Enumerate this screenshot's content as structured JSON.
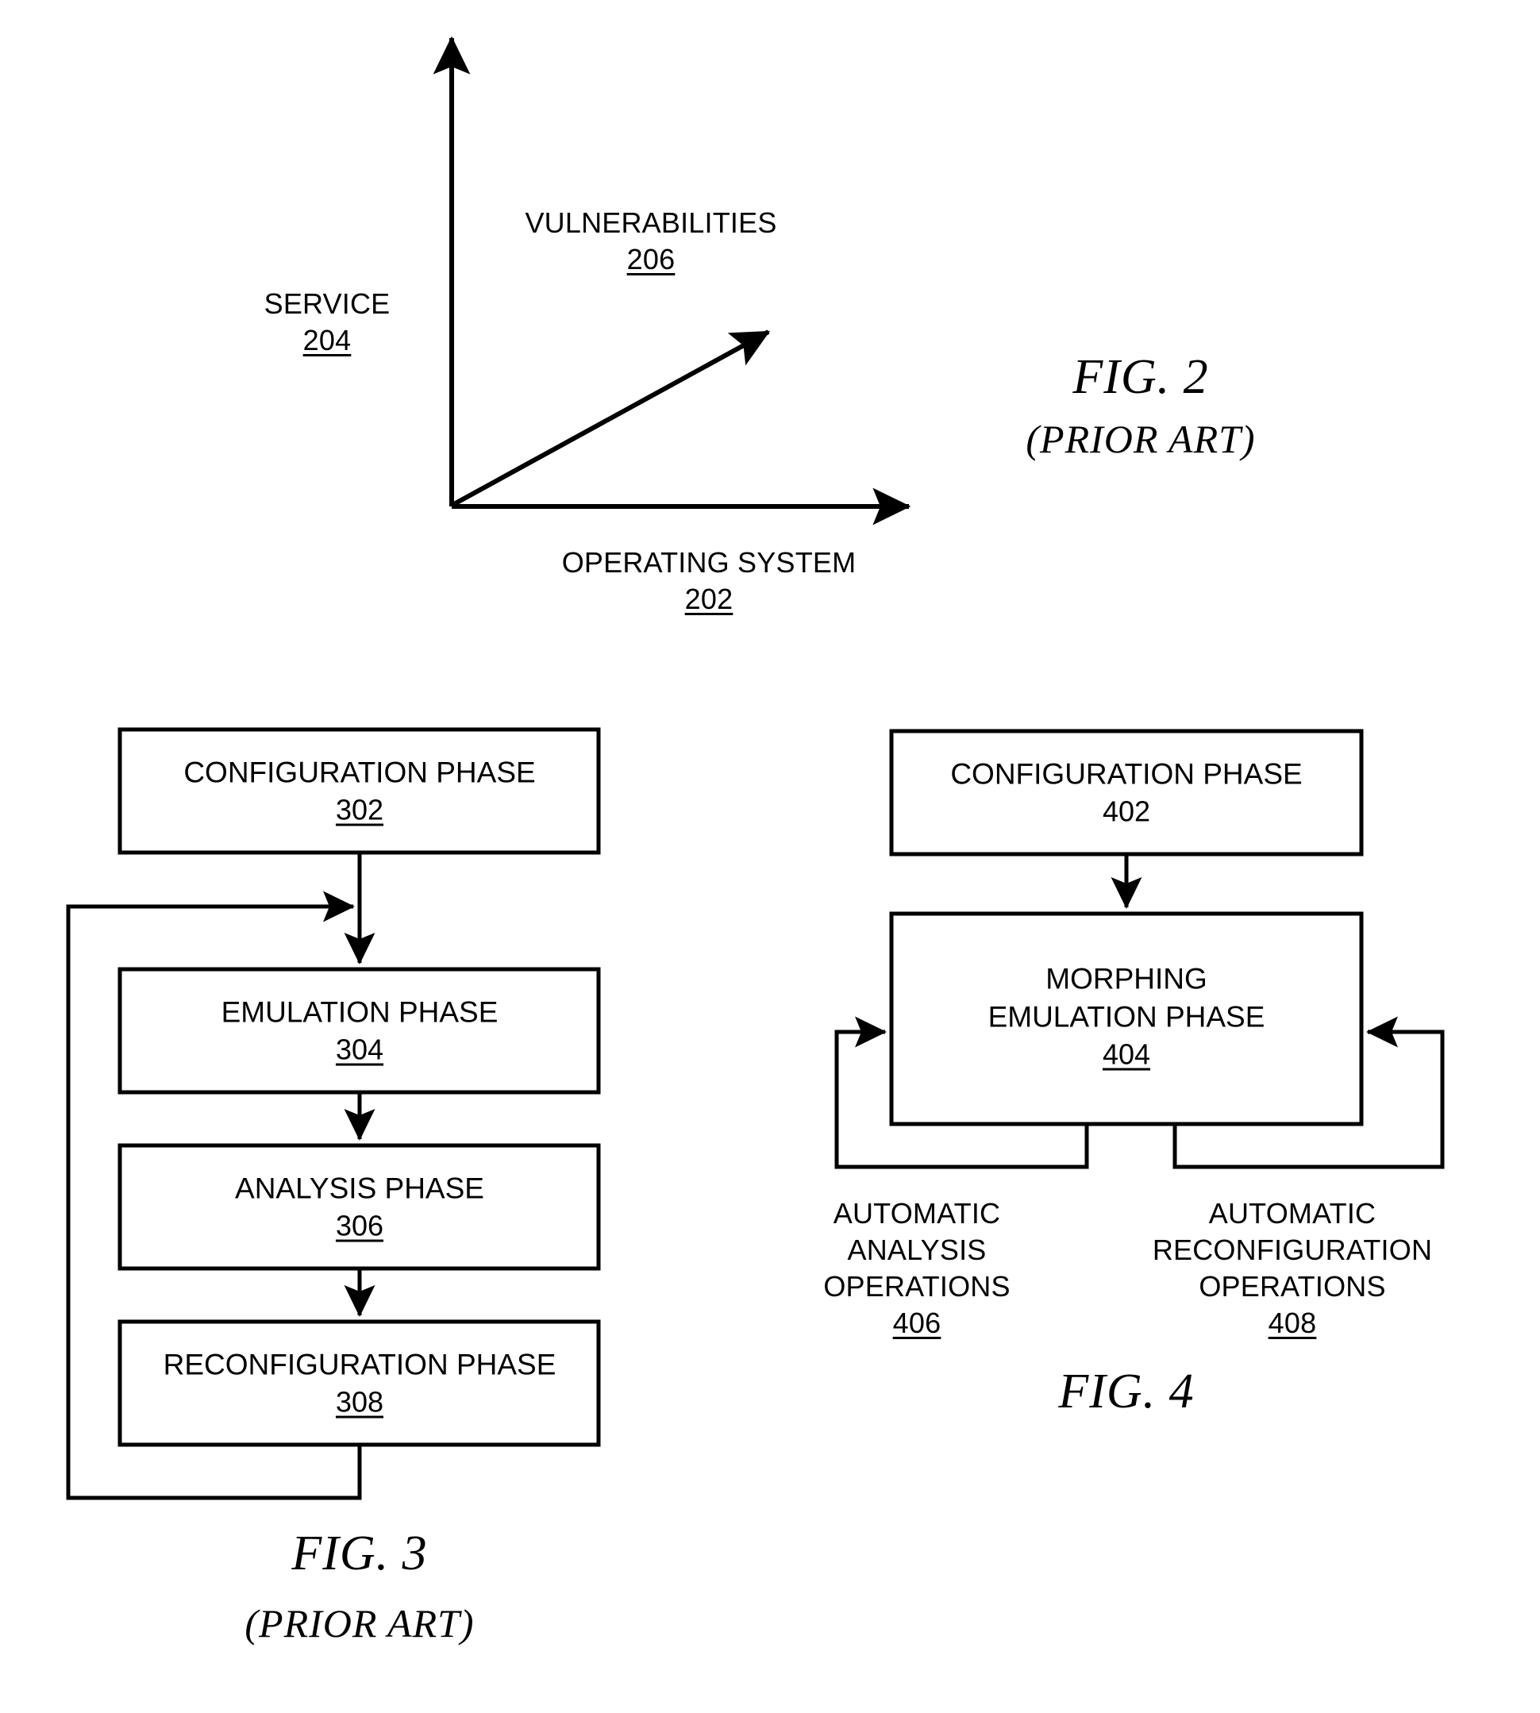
{
  "document": {
    "type": "patent-figure-sheet",
    "background_color": "#ffffff",
    "ink_color": "#000000"
  },
  "figures": [
    {
      "id": "fig2",
      "caption": "FIG. 2",
      "subcaption": "(PRIOR ART)",
      "kind": "axis-diagram",
      "axes": {
        "y_axis_label": "SERVICE",
        "y_axis_ref": "204",
        "x_axis_label": "OPERATING SYSTEM",
        "x_axis_ref": "202",
        "vector_label": "VULNERABILITIES",
        "vector_ref": "206"
      }
    },
    {
      "id": "fig3",
      "caption": "FIG. 3",
      "subcaption": "(PRIOR ART)",
      "kind": "flowchart",
      "boxes": [
        {
          "label": "CONFIGURATION PHASE",
          "ref": "302",
          "ref_underlined": true
        },
        {
          "label": "EMULATION PHASE",
          "ref": "304",
          "ref_underlined": true
        },
        {
          "label": "ANALYSIS PHASE",
          "ref": "306",
          "ref_underlined": true
        },
        {
          "label": "RECONFIGURATION PHASE",
          "ref": "308",
          "ref_underlined": true
        }
      ],
      "feedback_loop": "from RECONFIGURATION PHASE back to EMULATION PHASE"
    },
    {
      "id": "fig4",
      "caption": "FIG. 4",
      "subcaption": "",
      "kind": "flowchart",
      "boxes": [
        {
          "label": "CONFIGURATION PHASE",
          "ref": "402",
          "ref_underlined": false
        },
        {
          "label_line1": "MORPHING",
          "label_line2": "EMULATION PHASE",
          "ref": "404",
          "ref_underlined": true
        }
      ],
      "loops": [
        {
          "side": "left",
          "lines": [
            "AUTOMATIC",
            "ANALYSIS",
            "OPERATIONS"
          ],
          "ref": "406",
          "ref_underlined": true
        },
        {
          "side": "right",
          "lines": [
            "AUTOMATIC",
            "RECONFIGURATION",
            "OPERATIONS"
          ],
          "ref": "408",
          "ref_underlined": true
        }
      ]
    }
  ]
}
